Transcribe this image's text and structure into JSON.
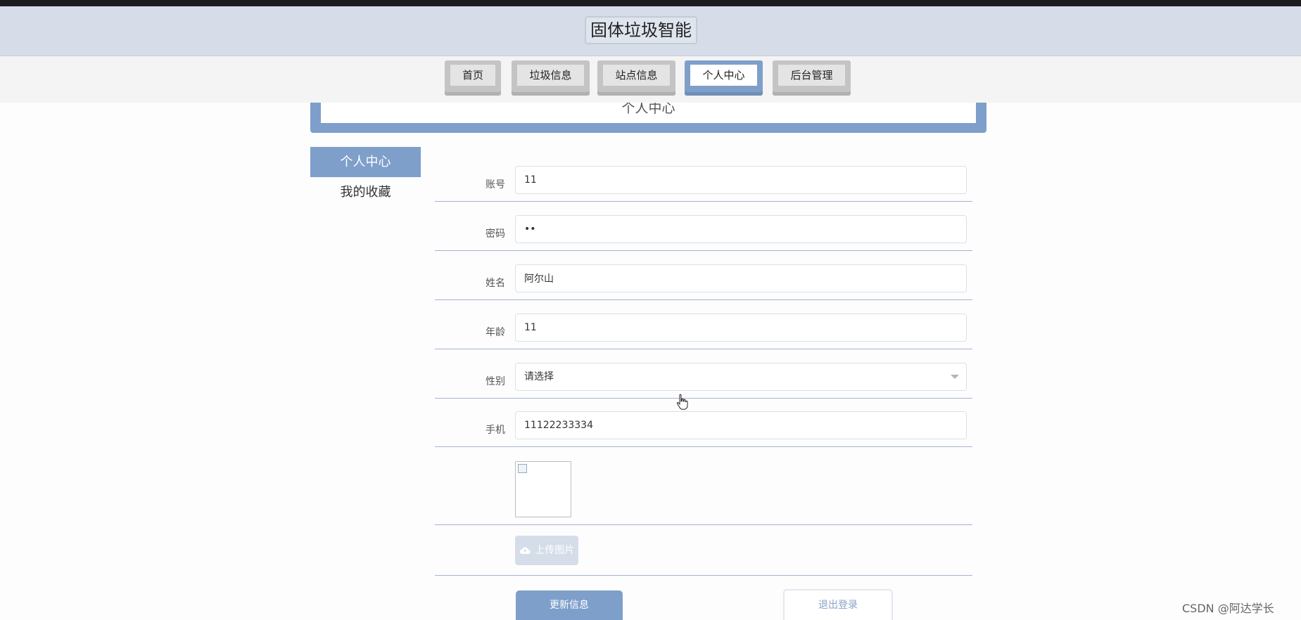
{
  "header": {
    "site_title": "固体垃圾智能"
  },
  "nav": {
    "items": [
      {
        "label": "首页",
        "active": false
      },
      {
        "label": "垃圾信息",
        "active": false
      },
      {
        "label": "站点信息",
        "active": false
      },
      {
        "label": "个人中心",
        "active": true
      },
      {
        "label": "后台管理",
        "active": false
      }
    ]
  },
  "banner": {
    "title": "个人中心"
  },
  "sidebar": {
    "items": [
      {
        "label": "个人中心",
        "active": true
      },
      {
        "label": "我的收藏",
        "active": false
      }
    ]
  },
  "form": {
    "account": {
      "label": "账号",
      "value": "11"
    },
    "password": {
      "label": "密码",
      "value": "••"
    },
    "name": {
      "label": "姓名",
      "value": "阿尔山"
    },
    "age": {
      "label": "年龄",
      "value": "11"
    },
    "gender": {
      "label": "性别",
      "placeholder": "请选择"
    },
    "phone": {
      "label": "手机",
      "value": "11122233334"
    },
    "upload_label": "上传图片"
  },
  "actions": {
    "update_label": "更新信息",
    "logout_label": "退出登录"
  },
  "watermark": "CSDN @阿达学长",
  "colors": {
    "accent": "#7e9fca",
    "header_bg": "#d6dde8",
    "upload_disabled": "#d5dde8"
  }
}
